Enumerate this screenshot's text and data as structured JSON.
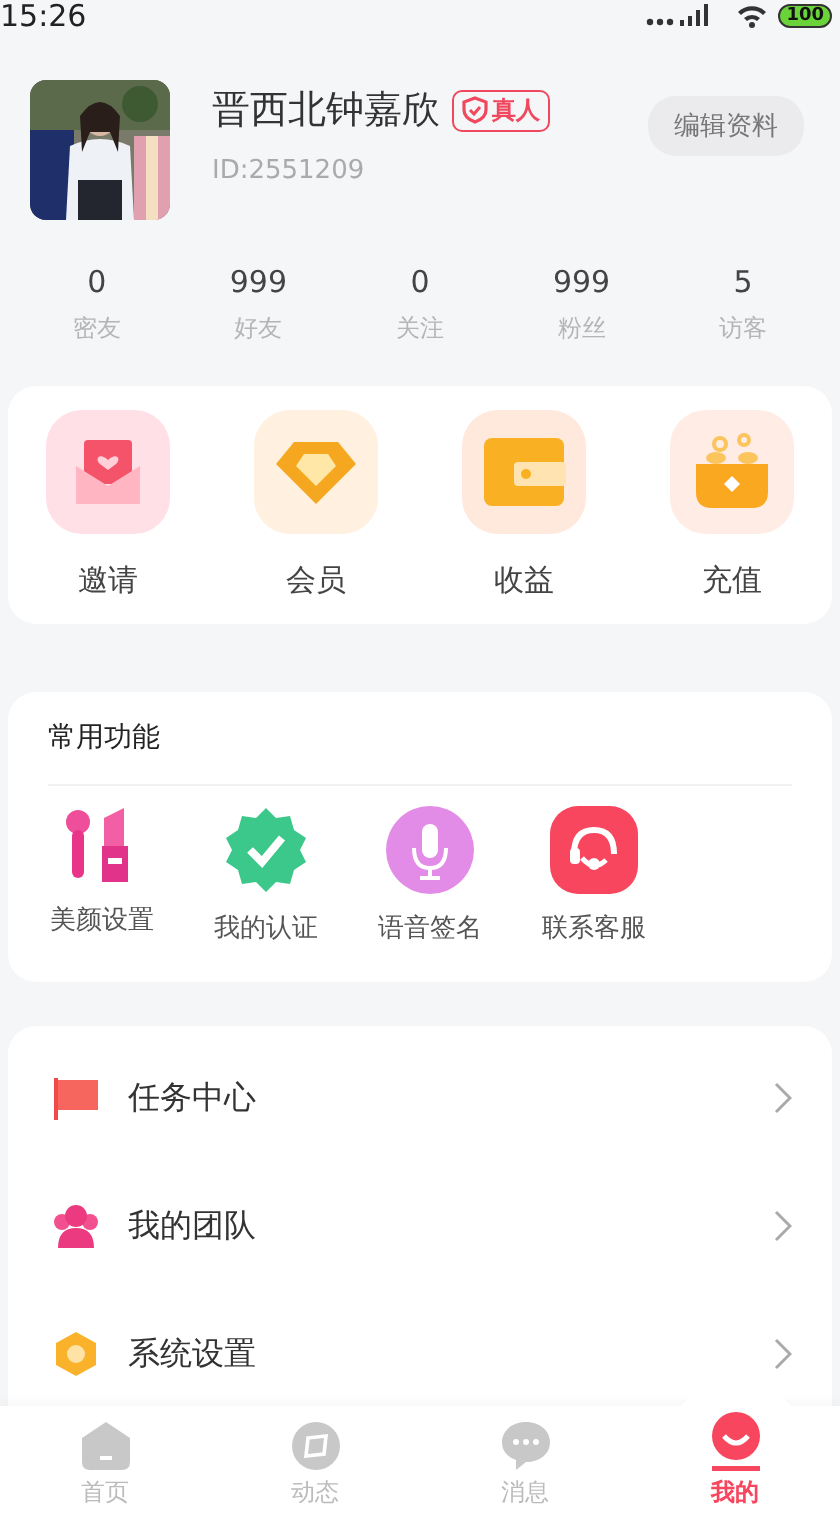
{
  "status_bar": {
    "time": "15:26",
    "battery": "100"
  },
  "profile": {
    "name": "晋西北钟嘉欣",
    "badge": "真人",
    "id": "ID:2551209",
    "edit_button": "编辑资料"
  },
  "stats": [
    {
      "value": "0",
      "label": "密友"
    },
    {
      "value": "999",
      "label": "好友"
    },
    {
      "value": "0",
      "label": "关注"
    },
    {
      "value": "999",
      "label": "粉丝"
    },
    {
      "value": "5",
      "label": "访客"
    }
  ],
  "quick_actions": [
    {
      "label": "邀请"
    },
    {
      "label": "会员"
    },
    {
      "label": "收益"
    },
    {
      "label": "充值"
    }
  ],
  "common_functions": {
    "title": "常用功能",
    "items": [
      {
        "label": "美颜设置"
      },
      {
        "label": "我的认证"
      },
      {
        "label": "语音签名"
      },
      {
        "label": "联系客服"
      }
    ]
  },
  "menu": [
    {
      "label": "任务中心"
    },
    {
      "label": "我的团队"
    },
    {
      "label": "系统设置"
    }
  ],
  "tab_bar": [
    {
      "label": "首页",
      "selected": false
    },
    {
      "label": "动态",
      "selected": false
    },
    {
      "label": "消息",
      "selected": false
    },
    {
      "label": "我的",
      "selected": true
    }
  ]
}
